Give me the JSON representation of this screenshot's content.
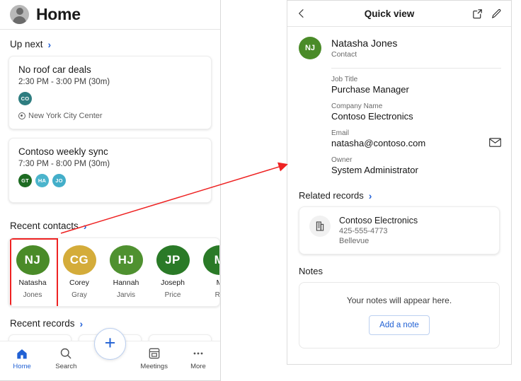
{
  "left_phone": {
    "header": {
      "title": "Home",
      "avatar_icon": "person-avatar-icon"
    },
    "up_next": {
      "section_label": "Up next",
      "chevron": "›",
      "meetings": [
        {
          "title": "No roof car deals",
          "time": "2:30 PM - 3:00 PM (30m)",
          "location": "New York City Center",
          "attendees": [
            {
              "initials": "CO",
              "color": "#2e7d80"
            }
          ]
        },
        {
          "title": "Contoso weekly sync",
          "time": "7:30 PM - 8:00 PM (30m)",
          "location": "",
          "attendees": [
            {
              "initials": "GT",
              "color": "#1d6b22"
            },
            {
              "initials": "HA",
              "color": "#4bb4cc"
            },
            {
              "initials": "JO",
              "color": "#43aec9"
            }
          ]
        }
      ]
    },
    "recent_contacts": {
      "section_label": "Recent contacts",
      "chevron": "›",
      "items": [
        {
          "initials": "NJ",
          "first": "Natasha",
          "last": "Jones",
          "color": "#4a8b28",
          "selected": true
        },
        {
          "initials": "CG",
          "first": "Corey",
          "last": "Gray",
          "color": "#d4ac3a",
          "selected": false
        },
        {
          "initials": "HJ",
          "first": "Hannah",
          "last": "Jarvis",
          "color": "#4f9130",
          "selected": false
        },
        {
          "initials": "JP",
          "first": "Joseph",
          "last": "Price",
          "color": "#2a7a27",
          "selected": false
        },
        {
          "initials": "M",
          "first": "M",
          "last": "Ro",
          "color": "#2a7a27",
          "selected": false
        }
      ]
    },
    "recent_records": {
      "section_label": "Recent records",
      "chevron": "›"
    },
    "bottom_nav": {
      "fab_label": "+",
      "items": [
        {
          "label": "Home",
          "icon": "home-icon",
          "active": true
        },
        {
          "label": "Search",
          "icon": "search-icon",
          "active": false
        },
        {
          "label": "Meetings",
          "icon": "meetings-icon",
          "active": false
        },
        {
          "label": "More",
          "icon": "more-icon",
          "active": false
        }
      ]
    }
  },
  "right_phone": {
    "header": {
      "title": "Quick view",
      "back_icon": "chevron-left-icon",
      "open_icon": "open-in-new-icon",
      "edit_icon": "pencil-edit-icon"
    },
    "person": {
      "initials": "NJ",
      "avatar_color": "#4a8b28",
      "name": "Natasha Jones",
      "entity_type": "Contact"
    },
    "fields": [
      {
        "label": "Job Title",
        "value": "Purchase Manager",
        "action_icon": ""
      },
      {
        "label": "Company Name",
        "value": "Contoso Electronics",
        "action_icon": ""
      },
      {
        "label": "Email",
        "value": "natasha@contoso.com",
        "action_icon": "envelope-icon"
      },
      {
        "label": "Owner",
        "value": "System Administrator",
        "action_icon": ""
      }
    ],
    "related_records": {
      "section_label": "Related records",
      "chevron": "›",
      "card": {
        "icon": "building-icon",
        "title": "Contoso Electronics",
        "phone": "425-555-4773",
        "city": "Bellevue"
      }
    },
    "notes": {
      "section_label": "Notes",
      "empty_text": "Your notes will appear here.",
      "add_button": "Add a note"
    }
  },
  "annotation": {
    "arrow_color": "#ee2222",
    "highlight_color": "#ee2222"
  }
}
